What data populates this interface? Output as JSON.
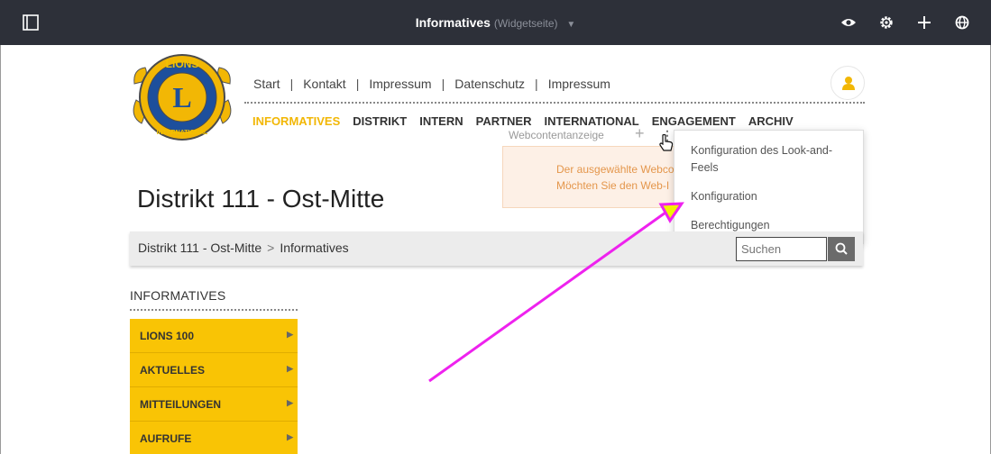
{
  "topbar": {
    "title": "Informatives",
    "subtitle": "(Widgetseite)",
    "icons": [
      "sidebar-toggle-icon",
      "eye-icon",
      "gear-icon",
      "plus-icon",
      "globe-icon"
    ]
  },
  "site": {
    "logo_text_top": "LIONS",
    "logo_letter": "L",
    "logo_text_bottom": "INTERNATIONAL",
    "top_nav": [
      "Start",
      "Kontakt",
      "Impressum",
      "Datenschutz",
      "Impressum"
    ],
    "top_nav_separator": "|",
    "main_nav": [
      "INFORMATIVES",
      "DISTRIKT",
      "INTERN",
      "PARTNER",
      "INTERNATIONAL",
      "ENGAGEMENT",
      "ARCHIV"
    ],
    "main_nav_active": "INFORMATIVES"
  },
  "portlet": {
    "title": "Webcontentanzeige",
    "plus": "+",
    "kebab": "⋮",
    "alert_line1": "Der ausgewählte Webco",
    "alert_line2": "Möchten Sie den Web-I"
  },
  "dropdown": {
    "items": [
      "Konfiguration des Look-and-Feels",
      "Konfiguration",
      "Berechtigungen"
    ]
  },
  "page": {
    "title": "Distrikt 111 - Ost-Mitte",
    "breadcrumb": [
      "Distrikt 111 - Ost-Mitte",
      "Informatives"
    ],
    "breadcrumb_separator": ">",
    "search_placeholder": "Suchen"
  },
  "sidebar": {
    "heading": "INFORMATIVES",
    "items": [
      "LIONS 100",
      "AKTUELLES",
      "MITTEILUNGEN",
      "AUFRUFE"
    ]
  },
  "colors": {
    "topbar": "#2d3039",
    "accent_yellow": "#f9c405",
    "nav_active": "#f2b705",
    "annotation_arrow": "#ee22ee"
  }
}
